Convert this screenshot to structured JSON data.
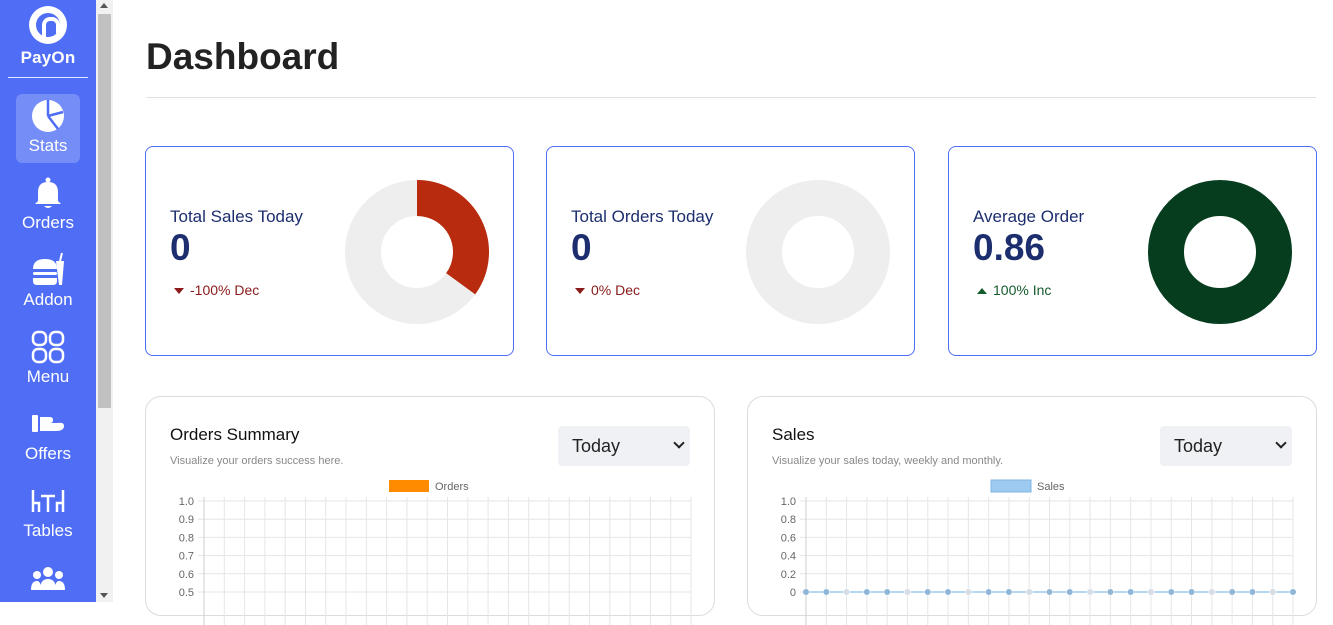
{
  "brand": {
    "name": "PayOn"
  },
  "sidebar": {
    "items": [
      {
        "label": "Stats",
        "icon": "pie-chart-icon",
        "active": true
      },
      {
        "label": "Orders",
        "icon": "bell-icon"
      },
      {
        "label": "Addon",
        "icon": "burger-drink-icon"
      },
      {
        "label": "Menu",
        "icon": "grid-icon"
      },
      {
        "label": "Offers",
        "icon": "hand-offer-icon"
      },
      {
        "label": "Tables",
        "icon": "table-chairs-icon"
      },
      {
        "label": "",
        "icon": "users-icon"
      }
    ]
  },
  "page": {
    "title": "Dashboard"
  },
  "stats": [
    {
      "label": "Total Sales Today",
      "value": "0",
      "trend": "-100% Dec",
      "direction": "dec",
      "donut_fraction": 0.35,
      "color": "#b82b0e",
      "track": "#eeeeee"
    },
    {
      "label": "Total Orders Today",
      "value": "0",
      "trend": "0% Dec",
      "direction": "dec",
      "donut_fraction": 0,
      "color": "#b82b0e",
      "track": "#eeeeee"
    },
    {
      "label": "Average Order",
      "value": "0.86",
      "trend": "100% Inc",
      "direction": "inc",
      "donut_fraction": 1,
      "color": "#063d1f",
      "track": "#eeeeee"
    }
  ],
  "panels": [
    {
      "title": "Orders Summary",
      "subtitle": "Visualize your orders success here.",
      "select_value": "Today"
    },
    {
      "title": "Sales",
      "subtitle": "Visualize your sales today, weekly and monthly.",
      "select_value": "Today"
    }
  ],
  "colors": {
    "sidebar": "#4f6df5",
    "accent": "#4f6df5",
    "dec": "#8b1a1a",
    "inc": "#145a2a"
  },
  "chart_data": [
    {
      "type": "bar",
      "title": "Orders Summary",
      "series": [
        {
          "name": "Orders",
          "color": "#ff8c00",
          "values": []
        }
      ],
      "yticks": [
        "1.0",
        "0.9",
        "0.8",
        "0.7",
        "0.6",
        "0.5"
      ],
      "ylim": [
        0,
        1
      ],
      "grid": true,
      "legend": "top-center"
    },
    {
      "type": "line",
      "title": "Sales",
      "series": [
        {
          "name": "Sales",
          "color": "#9ccaf0",
          "values": [
            0,
            0,
            0,
            0,
            0,
            0,
            0,
            0,
            0,
            0,
            0,
            0,
            0,
            0,
            0,
            0,
            0,
            0,
            0,
            0,
            0,
            0,
            0,
            0,
            0
          ]
        }
      ],
      "yticks": [
        "1.0",
        "0.8",
        "0.6",
        "0.4",
        "0.2",
        "0"
      ],
      "ylim": [
        0,
        1
      ],
      "grid": true,
      "legend": "top-center"
    }
  ]
}
